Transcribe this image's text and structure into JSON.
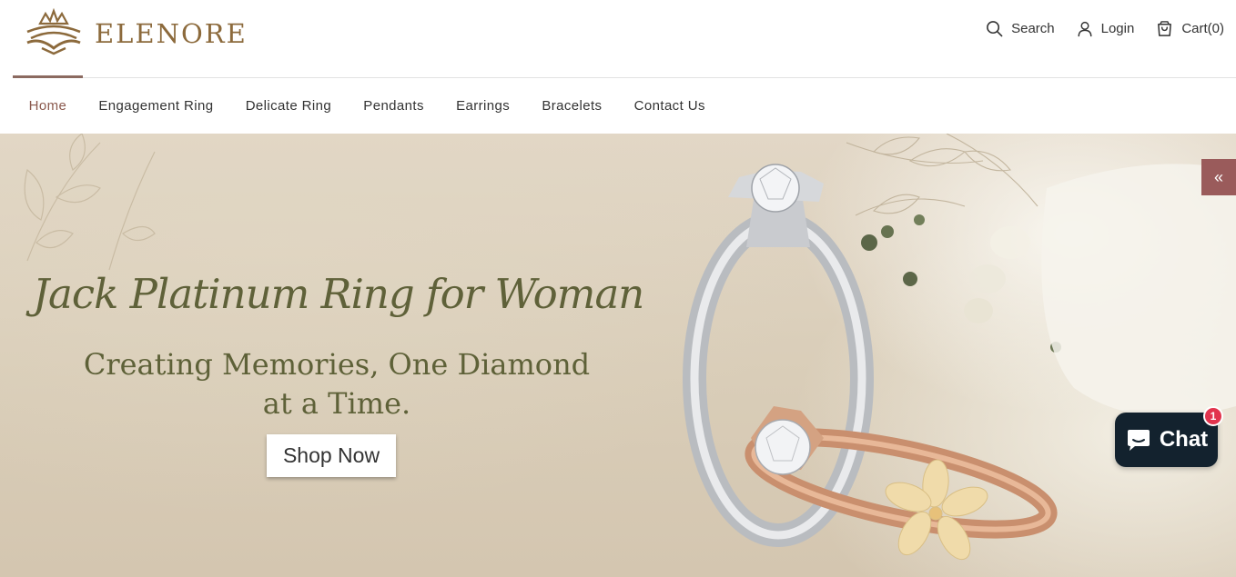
{
  "brand": {
    "name": "ELENORE",
    "accent": "#8c6a3c"
  },
  "header": {
    "search_label": "Search",
    "login_label": "Login",
    "cart_label": "Cart(0)"
  },
  "nav": {
    "items": [
      {
        "label": "Home",
        "active": true
      },
      {
        "label": "Engagement Ring"
      },
      {
        "label": "Delicate Ring"
      },
      {
        "label": "Pendants"
      },
      {
        "label": "Earrings"
      },
      {
        "label": "Bracelets"
      },
      {
        "label": "Contact Us"
      }
    ]
  },
  "hero": {
    "title": "Jack Platinum Ring for Woman",
    "subtitle_line1": "Creating Memories, One Diamond",
    "subtitle_line2": "at a Time.",
    "cta_label": "Shop Now",
    "side_tab_icon": "double-chevron-left-icon"
  },
  "chat": {
    "label": "Chat",
    "badge": "1",
    "color": "#13222e"
  },
  "icons": {
    "search": "search-icon",
    "login": "user-icon",
    "cart": "cart-icon",
    "logo": "crown-wave-logo-icon"
  }
}
